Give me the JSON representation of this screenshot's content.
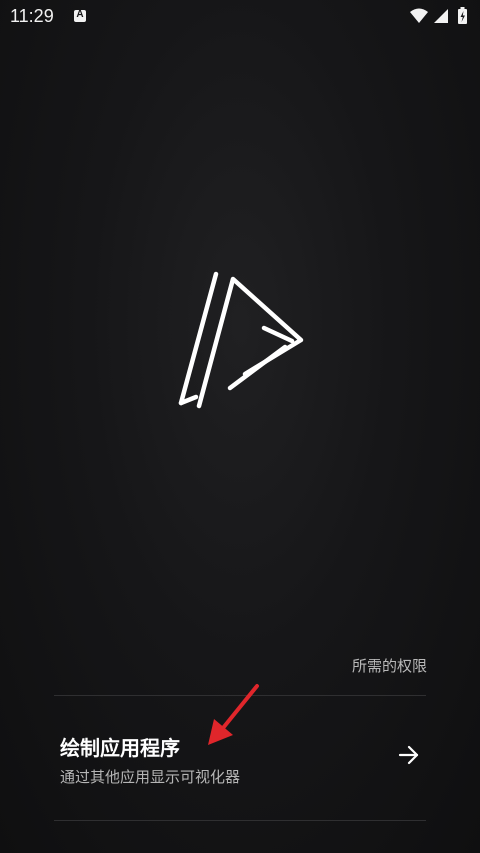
{
  "status_bar": {
    "time": "11:29",
    "notification_icon": "a-letter-icon",
    "icons": [
      "wifi-icon",
      "signal-icon",
      "battery-charging-icon"
    ]
  },
  "app_logo": {
    "icon": "play-triangle-logo-icon"
  },
  "permissions": {
    "section_title": "所需的权限",
    "items": [
      {
        "title": "绘制应用程序",
        "description": "通过其他应用显示可视化器",
        "icon": "arrow-right-icon"
      }
    ]
  },
  "annotation": {
    "icon": "red-pointer-arrow-icon",
    "color": "#e0262b"
  },
  "colors": {
    "background": "#161618",
    "text_primary": "#ffffff",
    "text_secondary": "#b5b5b5",
    "divider": "#2f2f31"
  }
}
